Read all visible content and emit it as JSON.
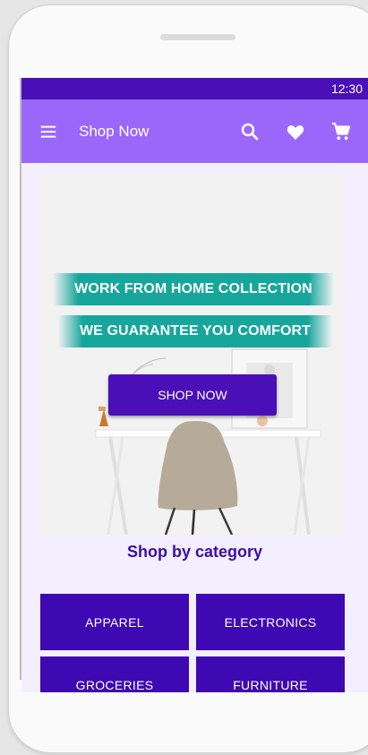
{
  "status": {
    "time": "12:30"
  },
  "appbar": {
    "title": "Shop Now",
    "menu_icon": "menu-icon",
    "search_icon": "search-icon",
    "favorite_icon": "heart-icon",
    "cart_icon": "cart-icon"
  },
  "hero": {
    "banner_line1": "WORK FROM HOME COLLECTION",
    "banner_line2": "WE GUARANTEE YOU COMFORT",
    "button_label": "SHOP NOW"
  },
  "categories": {
    "title": "Shop by category",
    "items": [
      {
        "label": "APPAREL"
      },
      {
        "label": "ELECTRONICS"
      },
      {
        "label": "GROCERIES"
      },
      {
        "label": "FURNITURE"
      }
    ]
  },
  "colors": {
    "status_bar": "#4a0fb7",
    "app_bar": "#9b67fa",
    "accent": "#3e09b3",
    "banner": "#16a69c"
  }
}
